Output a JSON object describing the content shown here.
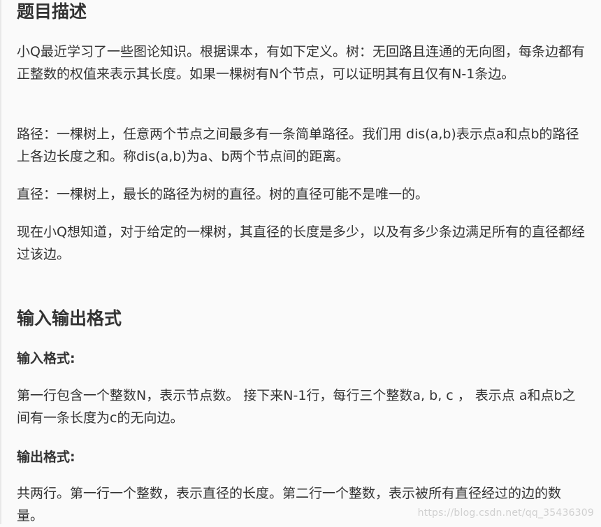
{
  "description": {
    "title": "题目描述",
    "paragraphs": [
      "小Q最近学习了一些图论知识。根据课本，有如下定义。树：无回路且连通的无向图，每条边都有正整数的权值来表示其长度。如果一棵树有N个节点，可以证明其有且仅有N-1条边。",
      "路径：一棵树上，任意两个节点之间最多有一条简单路径。我们用 dis(a,b)表示点a和点b的路径上各边长度之和。称dis(a,b)为a、b两个节点间的距离。",
      "直径：一棵树上，最长的路径为树的直径。树的直径可能不是唯一的。",
      "现在小Q想知道，对于给定的一棵树，其直径的长度是多少，以及有多少条边满足所有的直径都经过该边。"
    ]
  },
  "io": {
    "title": "输入输出格式",
    "input_label": "输入格式:",
    "input_text": "第一行包含一个整数N，表示节点数。 接下来N-1行，每行三个整数a, b, c ， 表示点 a和点b之间有一条长度为c的无向边。",
    "output_label": "输出格式:",
    "output_text": "共两行。第一行一个整数，表示直径的长度。第二行一个整数，表示被所有直径经过的边的数量。"
  },
  "watermark": "https://blog.csdn.net/qq_35436309"
}
